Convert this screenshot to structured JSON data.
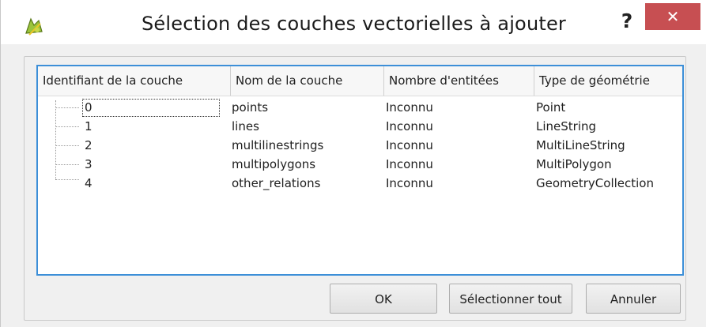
{
  "window": {
    "title": "Sélection des couches vectorielles à ajouter",
    "help_label": "?",
    "close_label": "✕",
    "app_icon": "qgis-icon"
  },
  "table": {
    "columns": [
      "Identifiant de la couche",
      "Nom de la couche",
      "Nombre d'entitées",
      "Type de géométrie"
    ],
    "rows": [
      [
        "0",
        "points",
        "Inconnu",
        "Point"
      ],
      [
        "1",
        "lines",
        "Inconnu",
        "LineString"
      ],
      [
        "2",
        "multilinestrings",
        "Inconnu",
        "MultiLineString"
      ],
      [
        "3",
        "multipolygons",
        "Inconnu",
        "MultiPolygon"
      ],
      [
        "4",
        "other_relations",
        "Inconnu",
        "GeometryCollection"
      ]
    ]
  },
  "buttons": {
    "ok": "OK",
    "select_all": "Sélectionner tout",
    "cancel": "Annuler"
  },
  "colors": {
    "accent_border": "#3c8fd8",
    "close_button": "#c74f52"
  }
}
